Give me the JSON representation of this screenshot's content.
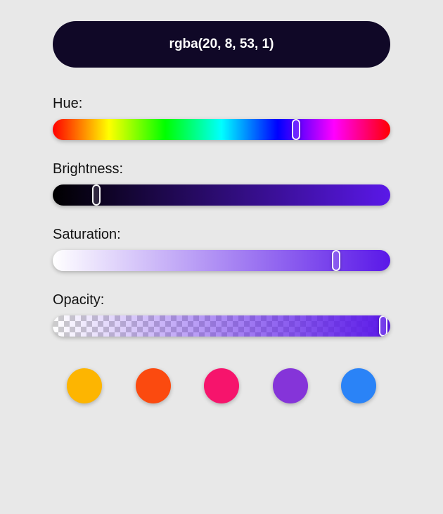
{
  "output": {
    "value": "rgba(20, 8, 53, 1)"
  },
  "primary_hue_color": "#5a18e8",
  "sliders": {
    "hue": {
      "label": "Hue:",
      "handle_percent": 72
    },
    "brightness": {
      "label": "Brightness:",
      "handle_percent": 13,
      "gradient_from": "#000000",
      "gradient_to": "#5a18e8"
    },
    "saturation": {
      "label": "Saturation:",
      "handle_percent": 84,
      "gradient_from": "#ffffff",
      "gradient_to": "#5a18e8"
    },
    "opacity": {
      "label": "Opacity:",
      "handle_percent": 98,
      "gradient_to": "#5a18e8"
    }
  },
  "swatches": [
    {
      "name": "amber",
      "color": "#fdb501"
    },
    {
      "name": "orange",
      "color": "#fb4a0f"
    },
    {
      "name": "pink",
      "color": "#f6146c"
    },
    {
      "name": "purple",
      "color": "#8534d9"
    },
    {
      "name": "blue",
      "color": "#2a83f7"
    }
  ]
}
